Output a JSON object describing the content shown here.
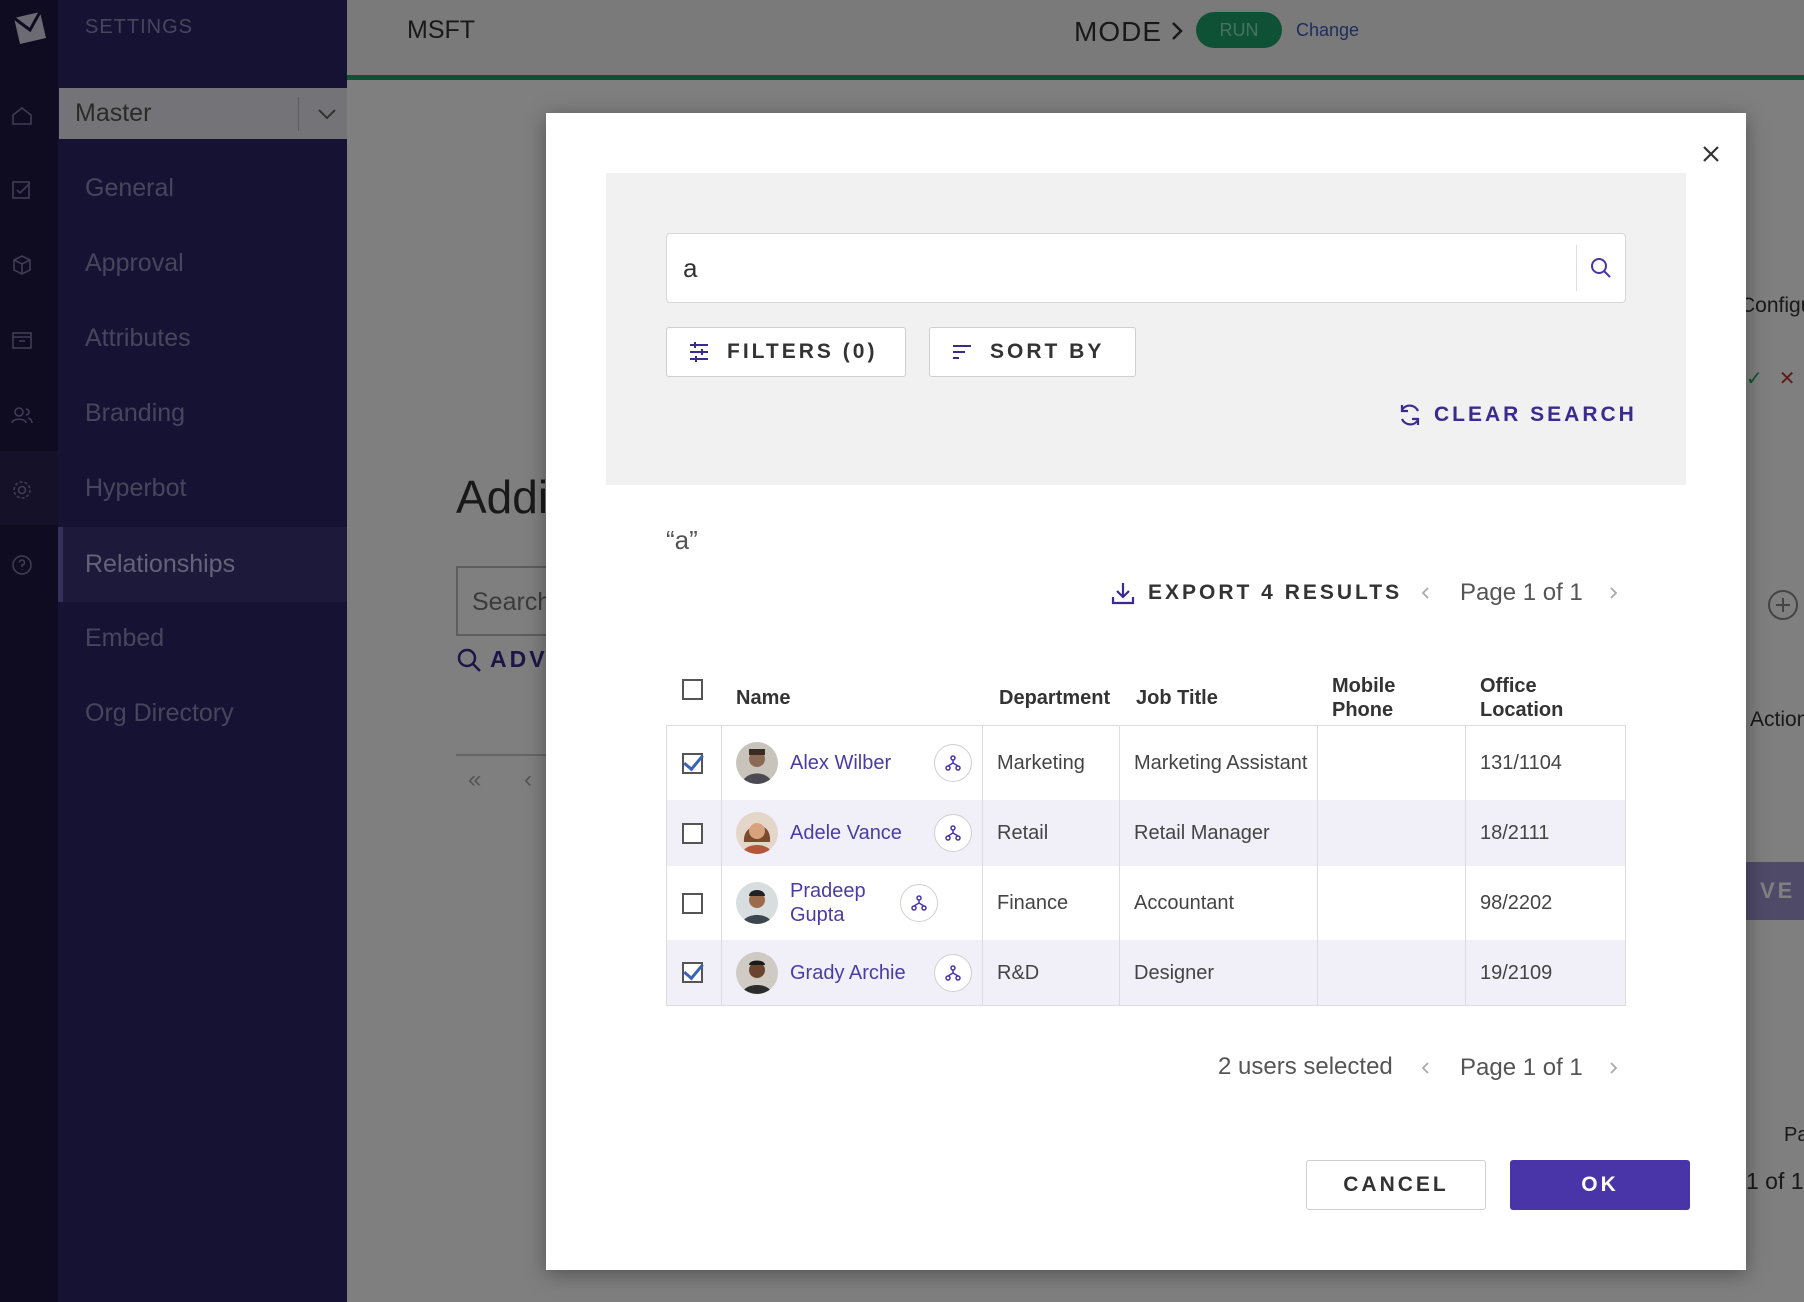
{
  "app": {
    "sidebar_title": "SETTINGS",
    "workspace_select": "Master",
    "sidebar_items": [
      "General",
      "Approval",
      "Attributes",
      "Branding",
      "Hyperbot",
      "Relationships",
      "Embed",
      "Org Directory"
    ],
    "active_item": "Relationships",
    "topbar": {
      "workspace": "MSFT",
      "mode_label": "MODE",
      "mode_value": "RUN",
      "change_label": "Change"
    },
    "behind": {
      "heading": "Addi",
      "search_placeholder": "Search",
      "advanced_label": "ADV.",
      "configu": "Configu",
      "action": "Action",
      "save_fragment": "VE",
      "tick": "✓",
      "cross": "✕",
      "page_fragment": "Pa",
      "of_fragment": "1 of 1"
    }
  },
  "modal": {
    "search": {
      "value": "a"
    },
    "filters_label": "FILTERS (0)",
    "sortby_label": "SORT BY",
    "clear_label": "CLEAR SEARCH",
    "query_label": "“a”",
    "export_label": "EXPORT 4 RESULTS",
    "page_label": "Page 1 of 1",
    "selected_count": "2 users selected",
    "columns": [
      "Name",
      "Department",
      "Job Title",
      "Mobile Phone",
      "Office Location"
    ],
    "rows": [
      {
        "name": "Alex Wilber",
        "department": "Marketing",
        "job_title": "Marketing Assistant",
        "mobile_phone": "",
        "office": "131/1104",
        "checked": true
      },
      {
        "name": "Adele Vance",
        "department": "Retail",
        "job_title": "Retail Manager",
        "mobile_phone": "",
        "office": "18/2111",
        "checked": false
      },
      {
        "name": "Pradeep Gupta",
        "department": "Finance",
        "job_title": "Accountant",
        "mobile_phone": "",
        "office": "98/2202",
        "checked": false
      },
      {
        "name": "Grady Archie",
        "department": "R&D",
        "job_title": "Designer",
        "mobile_phone": "",
        "office": "19/2109",
        "checked": true
      }
    ],
    "cancel_label": "CANCEL",
    "ok_label": "OK"
  },
  "colors": {
    "accent": "#4a35a8",
    "sidebar": "#2c2467",
    "run": "#1fa36a",
    "link": "#4b3ca5"
  }
}
